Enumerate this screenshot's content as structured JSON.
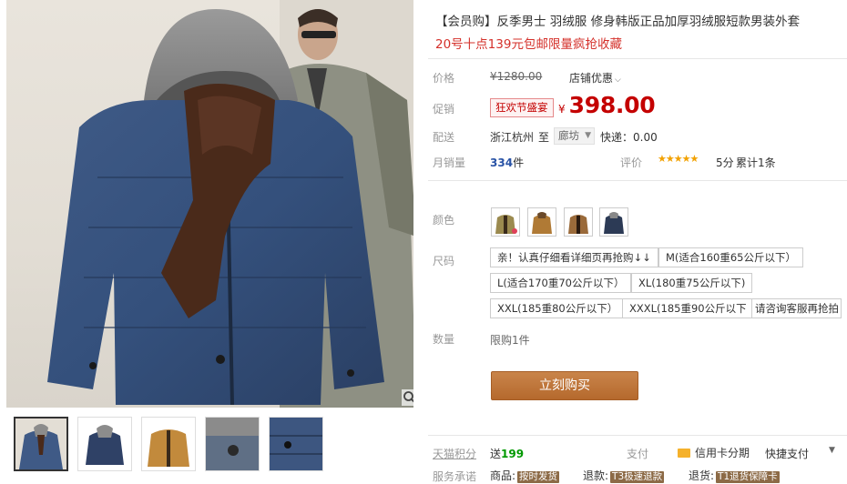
{
  "gallery": {
    "thumbnail_count": 5,
    "zoom_icon": "search-icon"
  },
  "product": {
    "title": "【会员购】反季男士 羽绒服 修身韩版正品加厚羽绒服短款男装外套",
    "subtitle": "20号十点139元包邮限量疯抢收藏"
  },
  "price_section": {
    "original_label": "价格",
    "original_price": "¥1280.00",
    "shop_discount": "店铺优惠",
    "promo_label": "促销",
    "promo_tag": "狂欢节盛宴",
    "currency": "¥",
    "promo_price": "398.00"
  },
  "delivery": {
    "label": "配送",
    "from": "浙江杭州",
    "to_word": "至",
    "destination": "廊坊",
    "shipping": "快递：0.00"
  },
  "sales": {
    "monthly_label": "月销量",
    "monthly_count": "334",
    "unit": "件",
    "rating_label": "评价",
    "stars": "★★★★★",
    "score": "5分",
    "reviews": "累计1条"
  },
  "options": {
    "color_label": "颜色",
    "colors": [
      "color-1",
      "color-2",
      "color-3",
      "color-4"
    ],
    "size_label": "尺码",
    "sizes": [
      "亲！认真仔细看详细页再抢购↓↓",
      "M(适合160重65公斤以下）",
      "L(适合170重70公斤以下）",
      "XL(180重75公斤以下)",
      "XXL(185重80公斤以下）",
      "XXXL(185重90公斤以下",
      "请咨询客服再抢拍"
    ],
    "quantity_label": "数量",
    "limit": "限购1件"
  },
  "buy_button": "立刻购买",
  "footer": {
    "points_label": "天猫积分",
    "points_prefix": "送",
    "points_value": "199",
    "pay_label": "支付",
    "credit": "信用卡分期",
    "quick_pay": "快捷支付",
    "service_label": "服务承诺",
    "goods_label": "商品:",
    "goods_badge": "按时发货",
    "refund_label": "退款:",
    "refund_badge": "T3极速退款",
    "return_label": "退货:",
    "return_badge": "T1退货保障卡"
  },
  "colors": {
    "price_red": "#c40000",
    "subtitle_red": "#d4302a",
    "buy_button": "#b5692d",
    "points_green": "#009900"
  }
}
